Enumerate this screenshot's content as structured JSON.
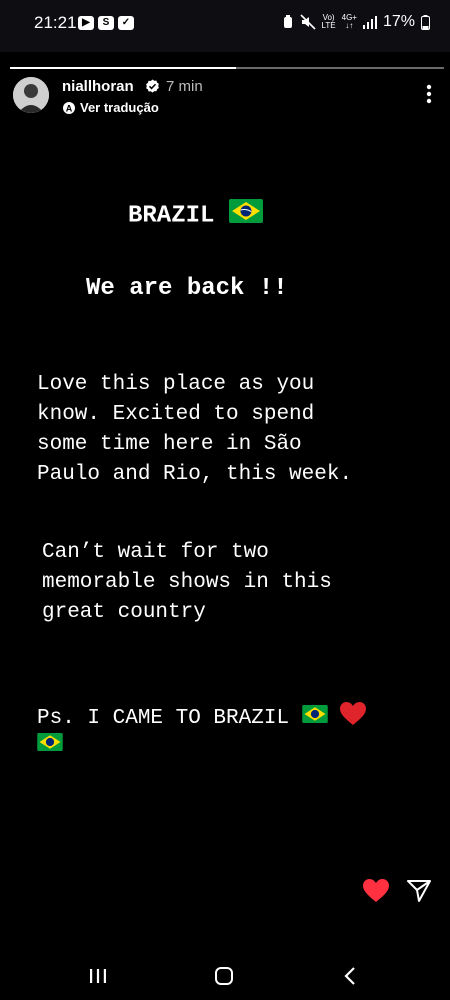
{
  "status_bar": {
    "time": "21:21",
    "signal_label_top": "Vo)",
    "signal_label_bottom": "LTE",
    "network_top": "4G+",
    "battery": "17%"
  },
  "story": {
    "progress_fraction": 0.52,
    "username": "niallhoran",
    "time_ago": "7 min",
    "translate_label": "Ver tradução",
    "lines": {
      "title": "BRAZIL",
      "subtitle": "We are back !!",
      "para1": "Love this place as you\nknow. Excited to spend\nsome time here in São\nPaulo and Rio, this week.",
      "para2": "Can’t wait for two\nmemorable shows in this\ngreat country",
      "ps": "Ps. I CAME TO BRAZIL"
    }
  },
  "colors": {
    "background": "#000000",
    "heart": "#ff3040",
    "flag_green": "#009c3b",
    "flag_yellow": "#ffdf00",
    "flag_blue": "#002776"
  },
  "icons": [
    "youtube-icon",
    "s-icon",
    "check-icon",
    "verified-icon",
    "translate-icon",
    "more-icon",
    "heart-icon",
    "send-icon",
    "recents-icon",
    "home-icon",
    "back-icon"
  ]
}
